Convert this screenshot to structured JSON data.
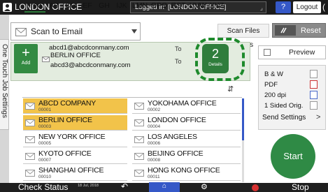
{
  "topbar": {
    "title": "LONDON OFFICE",
    "login_status": "Logged in: [LONDON OFFICE]",
    "help": "?",
    "logout": "Logout",
    "power": "("
  },
  "function": {
    "label": "Scan to Email"
  },
  "left_tab": {
    "label": "One Touch Job Settings"
  },
  "header_buttons": {
    "scan_files_status": "Scan Files Status",
    "reset": "Reset"
  },
  "destinations": {
    "add_label": "Add",
    "rows": [
      {
        "email": "abcd1@abcdconmany.com",
        "to": "To"
      },
      {
        "name": "BERLIN OFFICE",
        "email": "abcd3@abcdconmany.com",
        "to": "To"
      }
    ],
    "details_count": "2",
    "details_label": "Details"
  },
  "tabs": [
    "Freq.",
    "AB",
    "CD",
    "EF",
    "GH",
    "IJK",
    "LMN",
    "OPQ",
    "RST",
    "UVW",
    "XYZ"
  ],
  "more_icon": "⇵",
  "address_book": [
    {
      "name": "ABCD COMPANY",
      "number": "00001",
      "selected": true
    },
    {
      "name": "YOKOHAMA OFFICE",
      "number": "00002",
      "selected": false
    },
    {
      "name": "BERLIN OFFICE",
      "number": "00003",
      "selected": true
    },
    {
      "name": "LONDON OFFICE",
      "number": "00004",
      "selected": false
    },
    {
      "name": "NEW YORK OFFICE",
      "number": "00005",
      "selected": false
    },
    {
      "name": "LOS ANGELES",
      "number": "00006",
      "selected": false
    },
    {
      "name": "KYOTO OFFICE",
      "number": "00007",
      "selected": false
    },
    {
      "name": "BEIJING OFFICE",
      "number": "00008",
      "selected": false
    },
    {
      "name": "SHANGHAI OFFICE",
      "number": "00010",
      "selected": false
    },
    {
      "name": "HONG KONG OFFICE",
      "number": "00011",
      "selected": false
    }
  ],
  "right_panel": {
    "preview": "Preview",
    "settings": [
      "B & W",
      "PDF",
      "200 dpi",
      "1 Sided Orig."
    ],
    "send_settings": "Send Settings",
    "send_arrow": ">",
    "start": "Start"
  },
  "bottombar": {
    "check_status": "Check Status",
    "date": "18 Jul, 2018",
    "time": "11:18",
    "stop": "Stop"
  },
  "colors": {
    "accent_green": "#2f8a45",
    "selected_row": "#f2c34a",
    "top_bar": "#1c1c1c",
    "blue": "#3558c7"
  }
}
